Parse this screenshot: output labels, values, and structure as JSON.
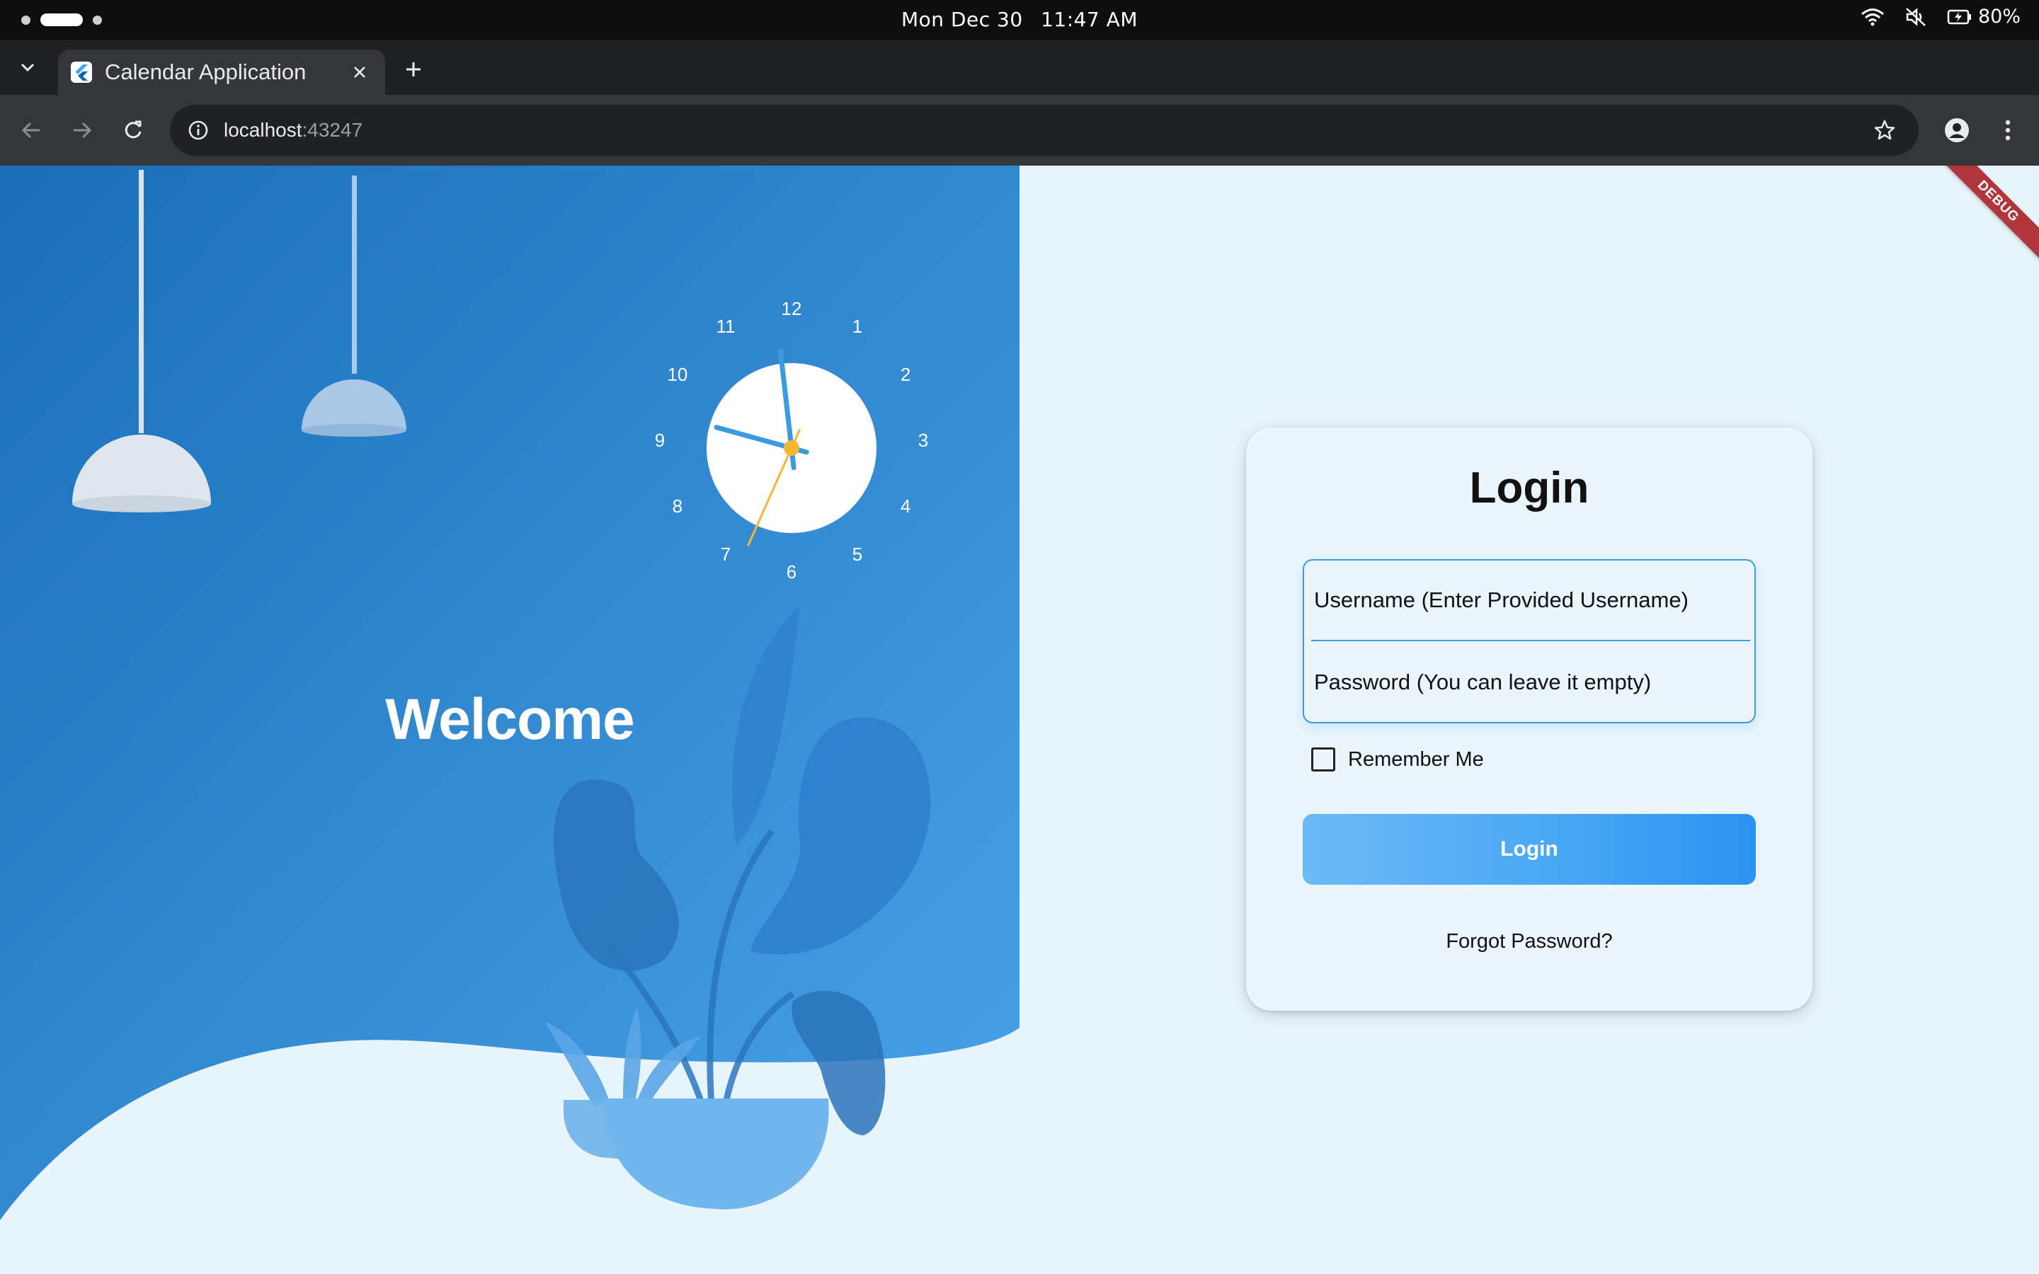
{
  "os_bar": {
    "date": "Mon Dec 30",
    "time": "11:47 AM",
    "battery": "80%"
  },
  "browser": {
    "tab_title": "Calendar Application",
    "url_host": "localhost",
    "url_port": ":43247"
  },
  "page": {
    "welcome": "Welcome",
    "debug_banner": "DEBUG",
    "clock": {
      "numbers": [
        "12",
        "1",
        "2",
        "3",
        "4",
        "5",
        "6",
        "7",
        "8",
        "9",
        "10",
        "11"
      ],
      "hour": 11,
      "minute": 47,
      "second": 34
    }
  },
  "login": {
    "title": "Login",
    "username_placeholder": "Username (Enter Provided Username)",
    "password_placeholder": "Password (You can leave it empty)",
    "remember_label": "Remember Me",
    "remember_checked": false,
    "button_label": "Login",
    "forgot_label": "Forgot Password?"
  },
  "colors": {
    "panel_dark": "#1a6fb8",
    "panel_light": "#4aa3e8",
    "page_bg": "#e8f4fb",
    "accent": "#3a9be0",
    "second_hand": "#f7b733"
  }
}
